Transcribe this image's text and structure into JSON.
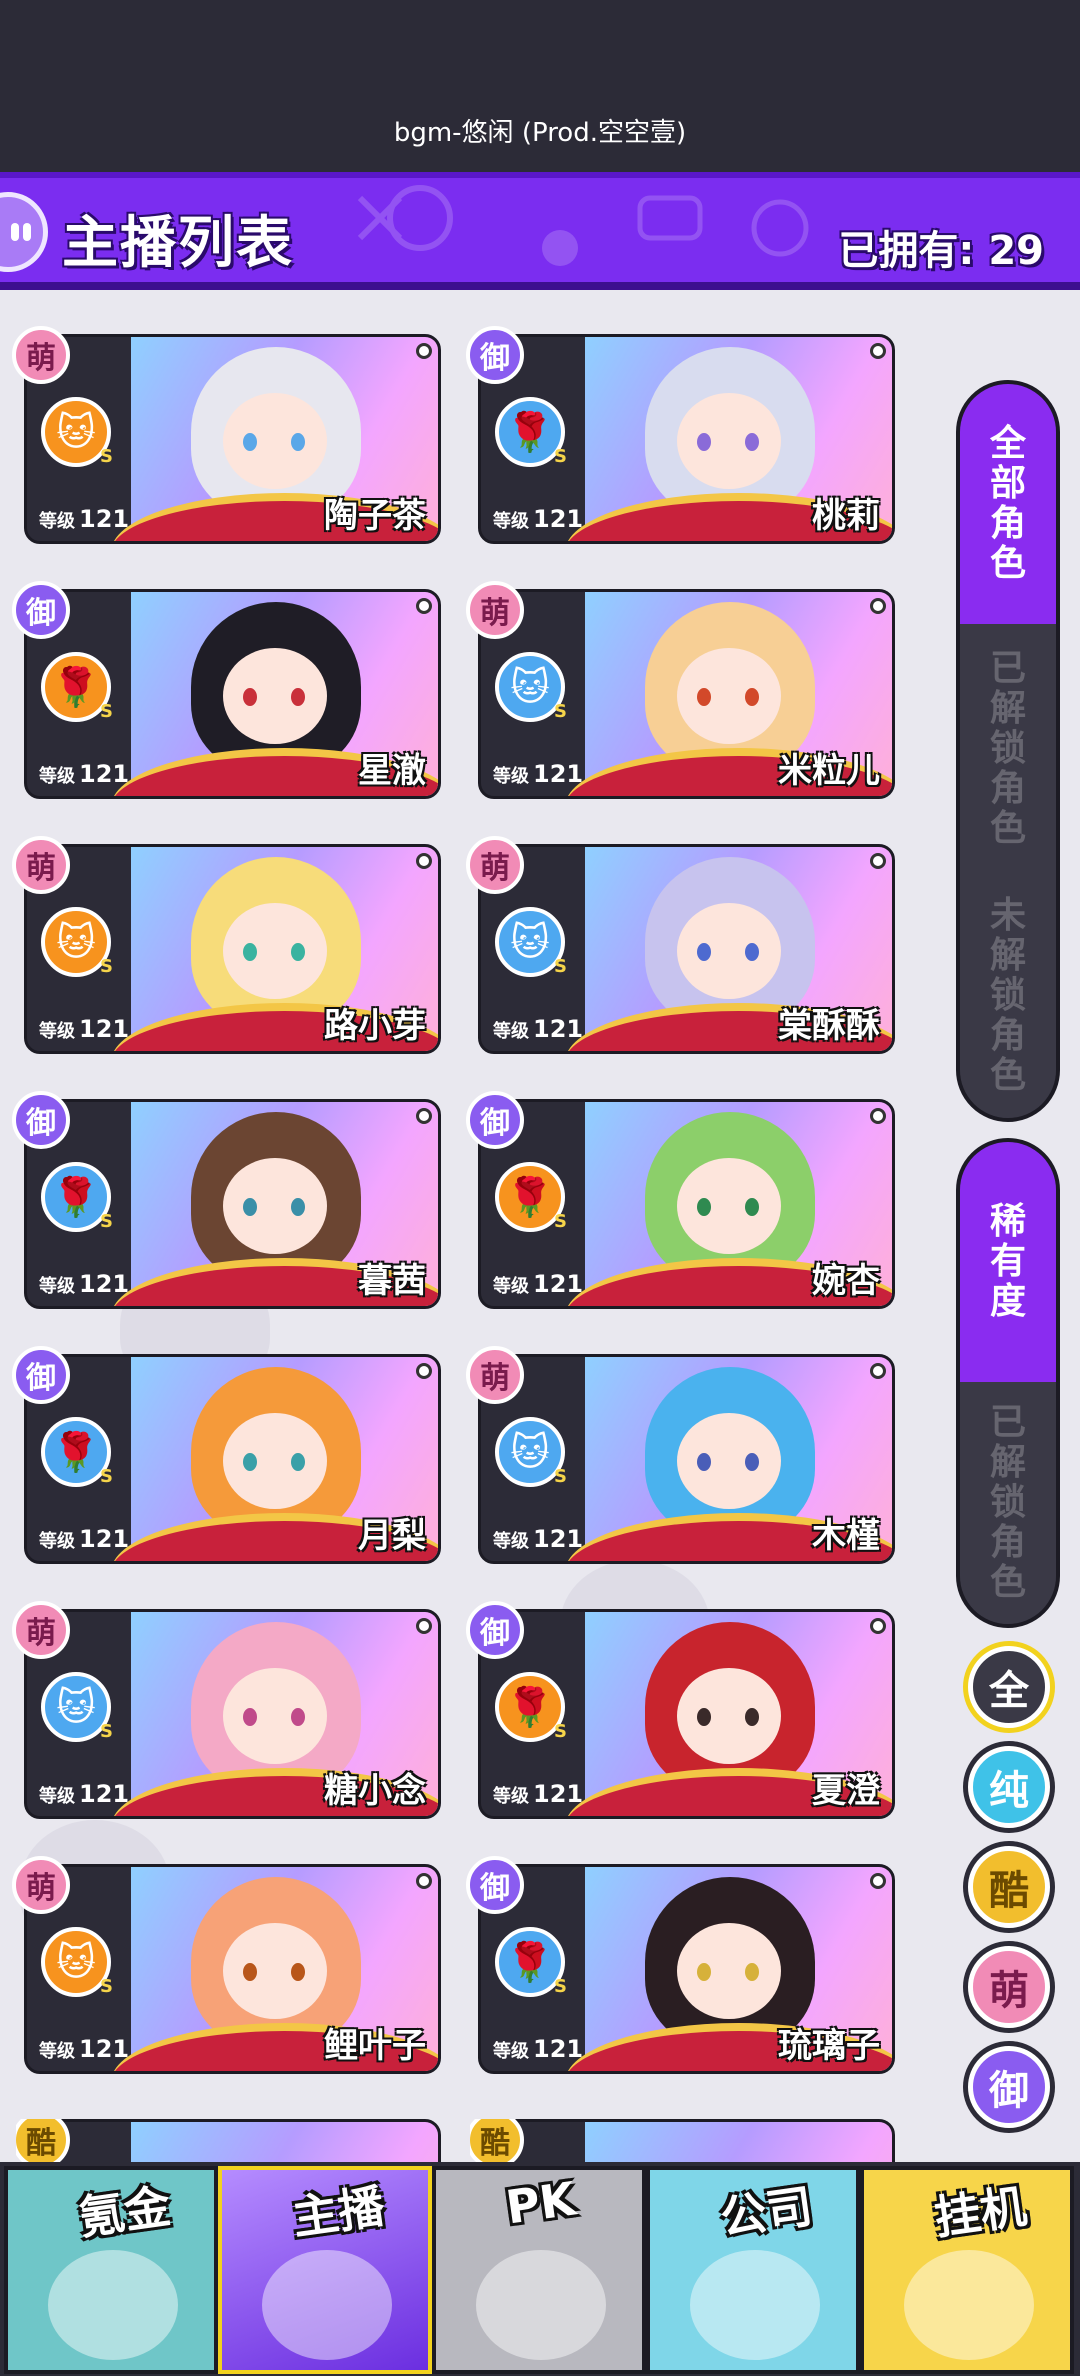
{
  "top": {
    "music": "bgm-悠闲 (Prod.空空壹)"
  },
  "header": {
    "title": "主播列表",
    "owned_label": "已拥有: 29"
  },
  "card_level_label": "等级",
  "cards": [
    {
      "name": "陶子茶",
      "level": "121",
      "badge": "萌",
      "type": "meng",
      "emblem": "cat",
      "emblem_color": "#f7931e",
      "hair": "#e7e7ef",
      "eye": "#5aa7e8"
    },
    {
      "name": "桃莉",
      "level": "121",
      "badge": "御",
      "type": "yu",
      "emblem": "rose",
      "emblem_color": "#4ea8f0",
      "hair": "#d8dcef",
      "eye": "#8a6bd8"
    },
    {
      "name": "星澈",
      "level": "121",
      "badge": "御",
      "type": "yu",
      "emblem": "rose",
      "emblem_color": "#f7931e",
      "hair": "#1f1d26",
      "eye": "#c9303a"
    },
    {
      "name": "米粒儿",
      "level": "121",
      "badge": "萌",
      "type": "meng",
      "emblem": "cat",
      "emblem_color": "#4ea8f0",
      "hair": "#f7cf95",
      "eye": "#d2492a"
    },
    {
      "name": "路小芽",
      "level": "121",
      "badge": "萌",
      "type": "meng",
      "emblem": "cat",
      "emblem_color": "#f7931e",
      "hair": "#f7dc7a",
      "eye": "#3ab3a0"
    },
    {
      "name": "棠酥酥",
      "level": "121",
      "badge": "萌",
      "type": "meng",
      "emblem": "cat",
      "emblem_color": "#4ea8f0",
      "hair": "#c7c3ee",
      "eye": "#4e6ad0"
    },
    {
      "name": "暮茜",
      "level": "121",
      "badge": "御",
      "type": "yu",
      "emblem": "rose",
      "emblem_color": "#4ea8f0",
      "hair": "#6b4532",
      "eye": "#3a8fa8"
    },
    {
      "name": "婉杏",
      "level": "121",
      "badge": "御",
      "type": "yu",
      "emblem": "rose",
      "emblem_color": "#f7931e",
      "hair": "#8ccf6a",
      "eye": "#2f8a50"
    },
    {
      "name": "月梨",
      "level": "121",
      "badge": "御",
      "type": "yu",
      "emblem": "rose",
      "emblem_color": "#4ea8f0",
      "hair": "#f59a3a",
      "eye": "#3aa0a8"
    },
    {
      "name": "木槿",
      "level": "121",
      "badge": "萌",
      "type": "meng",
      "emblem": "cat",
      "emblem_color": "#4ea8f0",
      "hair": "#4ab2ee",
      "eye": "#4a5eb8"
    },
    {
      "name": "糖小念",
      "level": "121",
      "badge": "萌",
      "type": "meng",
      "emblem": "cat",
      "emblem_color": "#4ea8f0",
      "hair": "#f4a9c6",
      "eye": "#c04a8a"
    },
    {
      "name": "夏澄",
      "level": "121",
      "badge": "御",
      "type": "yu",
      "emblem": "rose",
      "emblem_color": "#f7931e",
      "hair": "#c8242d",
      "eye": "#3a2a2a"
    },
    {
      "name": "鲤叶子",
      "level": "121",
      "badge": "萌",
      "type": "meng",
      "emblem": "cat",
      "emblem_color": "#f7931e",
      "hair": "#f7a277",
      "eye": "#b8561a"
    },
    {
      "name": "琉璃子",
      "level": "121",
      "badge": "御",
      "type": "yu",
      "emblem": "rose",
      "emblem_color": "#4ea8f0",
      "hair": "#2a1e22",
      "eye": "#d6b13a"
    }
  ],
  "partial_cards": [
    {
      "badge": "酷",
      "type": "ku"
    },
    {
      "badge": "酷",
      "type": "ku"
    }
  ],
  "side_tabs_group1": [
    {
      "label": "全部角色",
      "active": true
    },
    {
      "label": "已解锁角色",
      "active": false
    },
    {
      "label": "未解锁角色",
      "active": false
    }
  ],
  "side_tabs_group2": [
    {
      "label": "稀有度",
      "active": true
    },
    {
      "label": "已解锁角色",
      "active": false
    }
  ],
  "filters": [
    {
      "label": "全",
      "bg": "#3a3946",
      "fg": "#ffffff",
      "ring": "#f2d21e"
    },
    {
      "label": "纯",
      "bg": "#3fc2e8",
      "fg": "#ffffff",
      "ring": "#2c2b37"
    },
    {
      "label": "酷",
      "bg": "#f2be2d",
      "fg": "#6b4a00",
      "ring": "#2c2b37"
    },
    {
      "label": "萌",
      "bg": "#f18bb6",
      "fg": "#7a1b4d",
      "ring": "#2c2b37"
    },
    {
      "label": "御",
      "bg": "#8a5cf0",
      "fg": "#ffffff",
      "ring": "#2c2b37"
    }
  ],
  "bottom_nav": [
    {
      "label": "氪金",
      "active": false,
      "bg": "#6fc6c8"
    },
    {
      "label": "主播",
      "active": true,
      "bg": "#8a5cf0"
    },
    {
      "label": "PK",
      "active": false,
      "bg": "#b8b8bf"
    },
    {
      "label": "公司",
      "active": false,
      "bg": "#7fd6e8"
    },
    {
      "label": "挂机",
      "active": false,
      "bg": "#f7d54a"
    }
  ]
}
